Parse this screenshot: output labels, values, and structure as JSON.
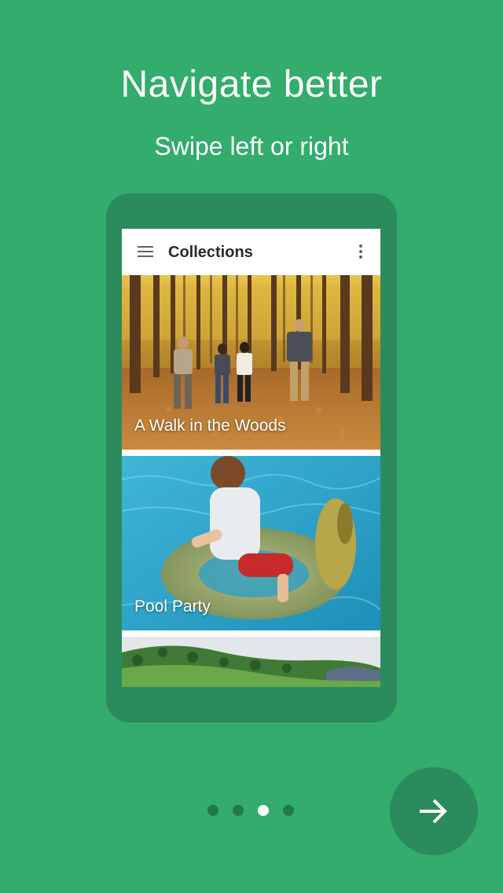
{
  "onboarding": {
    "title": "Navigate better",
    "subtitle": "Swipe left or right"
  },
  "app": {
    "title": "Collections",
    "menu_icon": "hamburger-menu-icon",
    "overflow_icon": "more-vert-icon"
  },
  "collections": [
    {
      "label": "A Walk in the Woods",
      "image": "autumn-forest-hikers-photo"
    },
    {
      "label": "Pool Party",
      "image": "child-on-pool-float-photo"
    },
    {
      "label": "",
      "image": "green-hills-landscape-photo"
    }
  ],
  "pager": {
    "page_count": 4,
    "active_page": 3
  },
  "next_button": {
    "icon": "arrow-forward-icon"
  },
  "colors": {
    "background": "#33ac6d",
    "phone_frame": "#2b8b5c",
    "dot_inactive": "#21784c",
    "dot_active": "#ffffff",
    "fab": "#2b8b5c"
  }
}
